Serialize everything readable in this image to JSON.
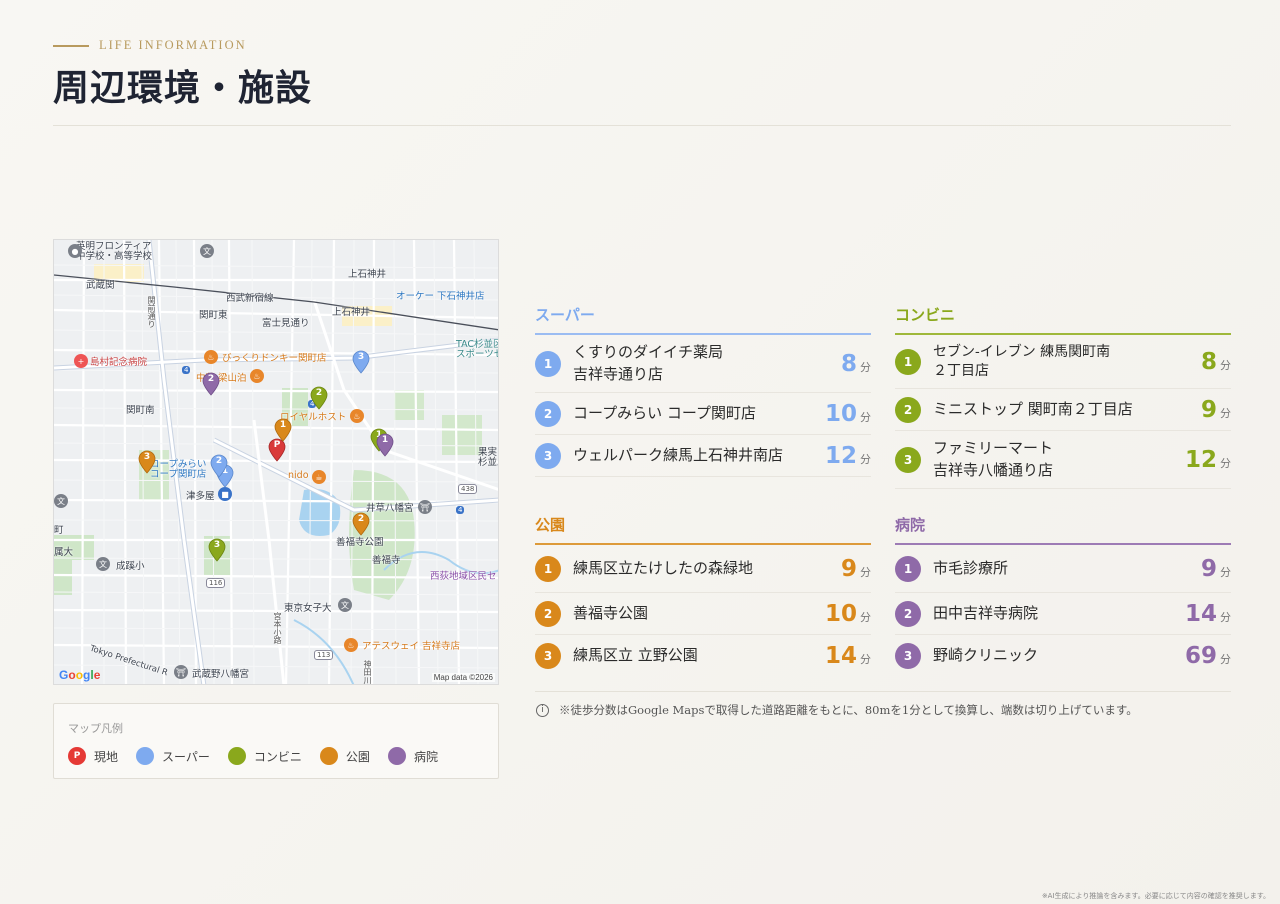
{
  "header": {
    "eyebrow": "LIFE INFORMATION",
    "title": "周辺環境・施設"
  },
  "map": {
    "labels": {
      "school": "英明フロンティア\n中学校・高等学校",
      "kamishakujii": "上石神井",
      "musashiseki": "武蔵関",
      "seibu_line": "西武新宿線",
      "kamishakujii_st": "上石神井",
      "okay_store": "オーケー 下石神井店",
      "sekimachi_higashi": "関町東",
      "fujimi_dori": "富士見通り",
      "sekimae_yasumichi": "関前通り",
      "tac": "TAC杉並区\nスポーツセ",
      "shimamura": "島村記念病院",
      "bikkuri": "びっくりドンキー関町店",
      "nakayama": "中華 梁山泊",
      "sekimachi_minami": "関町南",
      "royal": "ロイヤルホスト",
      "coop": "コープみらい\nコープ関町店",
      "nido": "nido",
      "tsutaya": "津多屋",
      "kajitsu": "果実\n杉並上",
      "idohachiman": "井草八幡宮",
      "zenpukuji_park": "善福寺公園",
      "zenpukuji": "善福寺",
      "nishiogi": "西荻地域区民セ",
      "seijo": "成蹊小",
      "tokyo_joshi": "東京女子大",
      "ates": "アテスウェイ 吉祥寺店",
      "musashino_hachiman": "武蔵野八幡宮",
      "tokyo_pref": "Tokyo Prefectural R",
      "route_438": "438",
      "route_116": "116",
      "route_113": "113",
      "route_4a": "4",
      "route_4b": "4",
      "route_4c": "4",
      "miyamoto": "宮本小路",
      "kanda": "神田川",
      "machi": "町",
      "tai": "属大"
    },
    "google": [
      "G",
      "o",
      "o",
      "g",
      "l",
      "e"
    ],
    "credit": "Map data ©2026",
    "pins": {
      "current": "P",
      "s1": "1",
      "s2": "2",
      "s3": "3",
      "c1": "1",
      "c2": "2",
      "c3": "3",
      "p1": "1",
      "p2": "2",
      "p3": "3",
      "h1": "1",
      "h2": "2",
      "h3": "3"
    }
  },
  "legend": {
    "title": "マップ凡例",
    "items": [
      {
        "symbol": "P",
        "label": "現地",
        "color": "#e53935"
      },
      {
        "symbol": "",
        "label": "スーパー",
        "color": "#7eaaef"
      },
      {
        "symbol": "",
        "label": "コンビニ",
        "color": "#8aa81c"
      },
      {
        "symbol": "",
        "label": "公園",
        "color": "#d9881b"
      },
      {
        "symbol": "",
        "label": "病院",
        "color": "#8f6aa8"
      }
    ]
  },
  "categories": {
    "super": {
      "title": "スーパー",
      "color": "#7eaaef",
      "items": [
        {
          "num": "1",
          "name": "くすりのダイイチ薬局\n吉祥寺通り店",
          "min": "8",
          "unit": "分"
        },
        {
          "num": "2",
          "name": "コープみらい コープ関町店",
          "min": "10",
          "unit": "分"
        },
        {
          "num": "3",
          "name": "ウェルパーク練馬上石神井南店",
          "min": "12",
          "unit": "分"
        }
      ]
    },
    "konbini": {
      "title": "コンビニ",
      "color": "#8aa81c",
      "items": [
        {
          "num": "1",
          "name": "セブン-イレブン 練馬関町南\n２丁目店",
          "min": "8",
          "unit": "分"
        },
        {
          "num": "2",
          "name": "ミニストップ 関町南２丁目店",
          "min": "9",
          "unit": "分"
        },
        {
          "num": "3",
          "name": "ファミリーマート\n吉祥寺八幡通り店",
          "min": "12",
          "unit": "分"
        }
      ]
    },
    "park": {
      "title": "公園",
      "color": "#d9881b",
      "items": [
        {
          "num": "1",
          "name": "練馬区立たけしたの森緑地",
          "min": "9",
          "unit": "分"
        },
        {
          "num": "2",
          "name": "善福寺公園",
          "min": "10",
          "unit": "分"
        },
        {
          "num": "3",
          "name": "練馬区立 立野公園",
          "min": "14",
          "unit": "分"
        }
      ]
    },
    "hospital": {
      "title": "病院",
      "color": "#8f6aa8",
      "items": [
        {
          "num": "1",
          "name": "市毛診療所",
          "min": "9",
          "unit": "分"
        },
        {
          "num": "2",
          "name": "田中吉祥寺病院",
          "min": "14",
          "unit": "分"
        },
        {
          "num": "3",
          "name": "野崎クリニック",
          "min": "69",
          "unit": "分"
        }
      ]
    }
  },
  "note": {
    "icon": "i",
    "text": "※徒歩分数はGoogle Mapsで取得した道路距離をもとに、80mを1分として換算し、端数は切り上げています。"
  },
  "footer": "※AI生成により推論を含みます。必要に応じて内容の確認を推奨します。"
}
